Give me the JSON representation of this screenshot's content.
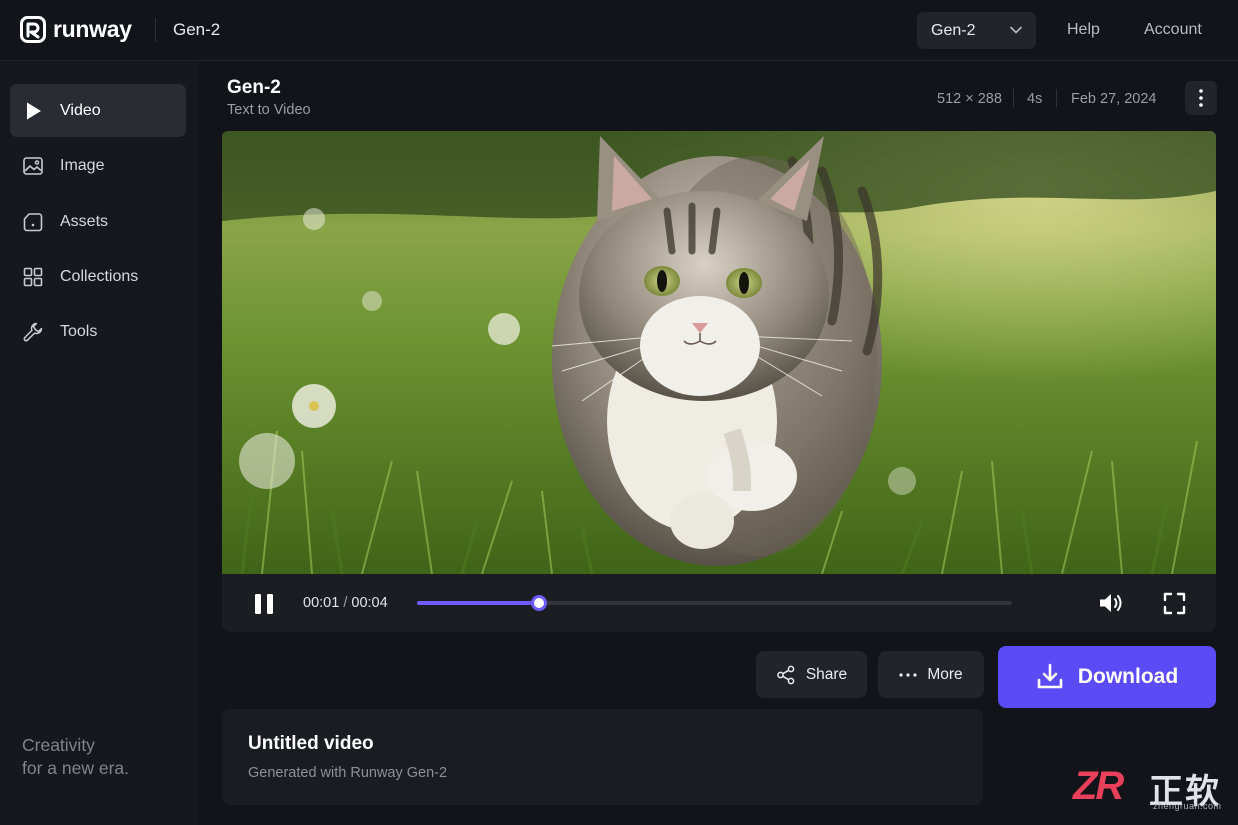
{
  "brand": {
    "name": "runway",
    "logo_icon": "runway-logo-icon"
  },
  "header": {
    "breadcrumb": "Gen-2",
    "model_select": {
      "value": "Gen-2",
      "icon": "chevron-down-icon"
    },
    "links": {
      "help": "Help",
      "account": "Account"
    }
  },
  "sidebar": {
    "items": [
      {
        "label": "Video",
        "icon": "play-icon",
        "active": true
      },
      {
        "label": "Image",
        "icon": "image-icon",
        "active": false
      },
      {
        "label": "Assets",
        "icon": "folder-icon",
        "active": false
      },
      {
        "label": "Collections",
        "icon": "grid-icon",
        "active": false
      },
      {
        "label": "Tools",
        "icon": "wrench-icon",
        "active": false
      }
    ],
    "tagline": {
      "line1": "Creativity",
      "line2": "for a new era."
    }
  },
  "main": {
    "title": "Gen-2",
    "subtitle": "Text to Video",
    "meta": {
      "resolution": "512 × 288",
      "duration": "4s",
      "date": "Feb 27, 2024"
    },
    "more_icon": "vertical-dots-icon"
  },
  "player": {
    "current_time": "00:01",
    "separator": " / ",
    "total_time": "00:04",
    "progress_fraction": 0.205,
    "accent_color": "#6d5bff",
    "icons": {
      "pause": "pause-icon",
      "volume": "volume-icon",
      "fullscreen": "fullscreen-icon"
    }
  },
  "actions": {
    "share_label": "Share",
    "more_label": "More",
    "download_label": "Download",
    "download_color": "#5b4bf6"
  },
  "video_card": {
    "title": "Untitled video",
    "subtitle": "Generated with Runway Gen-2"
  },
  "watermark": {
    "mark": "ZR",
    "chinese": "正软",
    "url": "zhengruan.com"
  }
}
